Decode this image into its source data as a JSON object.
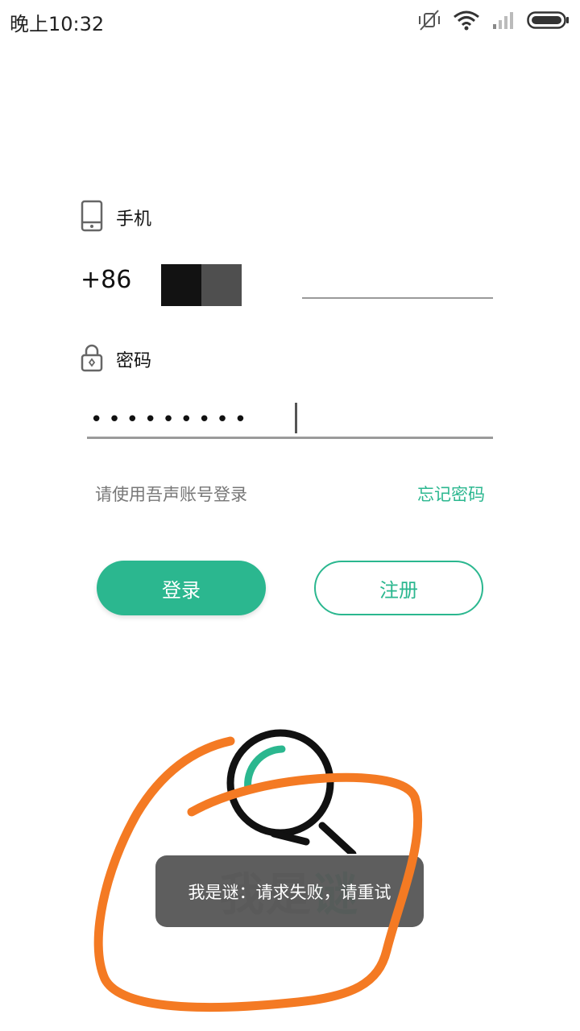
{
  "status_bar": {
    "time": "晚上10:32",
    "icons": [
      "mute-icon",
      "wifi-icon",
      "signal-icon",
      "battery-icon"
    ]
  },
  "form": {
    "phone_label": "手机",
    "phone_prefix": "+86",
    "password_label": "密码",
    "password_masked": "•••••••••",
    "hint": "请使用吾声账号登录",
    "forgot_password": "忘记密码"
  },
  "buttons": {
    "login": "登录",
    "register": "注册"
  },
  "logo": {
    "text_dark": "我是",
    "text_green": "谜"
  },
  "toast": {
    "message": "我是谜：请求失败，请重试"
  },
  "colors": {
    "accent": "#2bb78f",
    "annotation": "#f47a23",
    "toast_bg": "#505050"
  }
}
